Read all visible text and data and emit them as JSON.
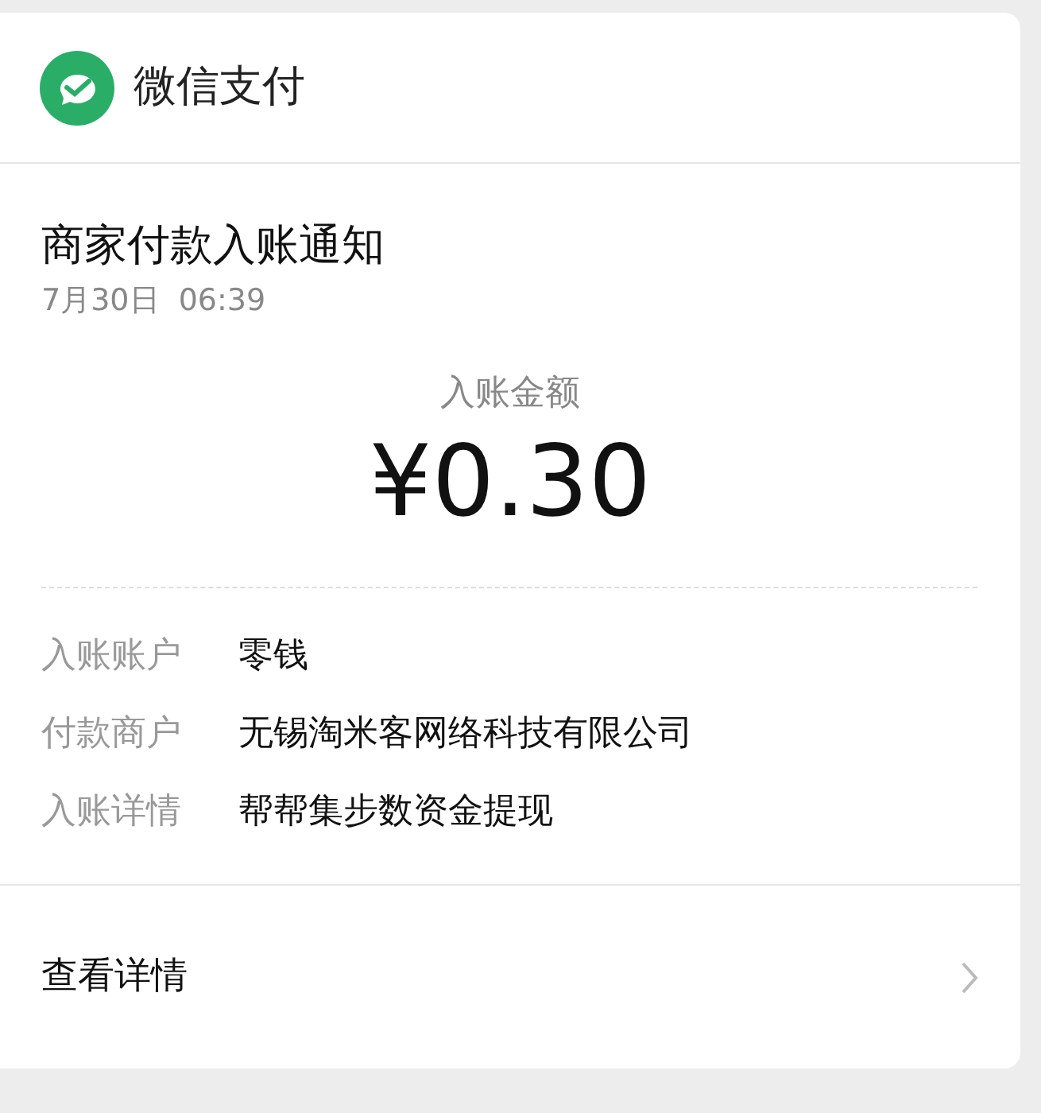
{
  "header": {
    "title": "微信支付"
  },
  "notice": {
    "title": "商家付款入账通知",
    "time": "7月30日  06:39"
  },
  "amount": {
    "label": "入账金额",
    "value": "¥0.30"
  },
  "details": [
    {
      "label": "入账账户",
      "value": "零钱"
    },
    {
      "label": "付款商户",
      "value": "无锡淘米客网络科技有限公司"
    },
    {
      "label": "入账详情",
      "value": "帮帮集步数资金提现"
    }
  ],
  "footer": {
    "link": "查看详情"
  }
}
